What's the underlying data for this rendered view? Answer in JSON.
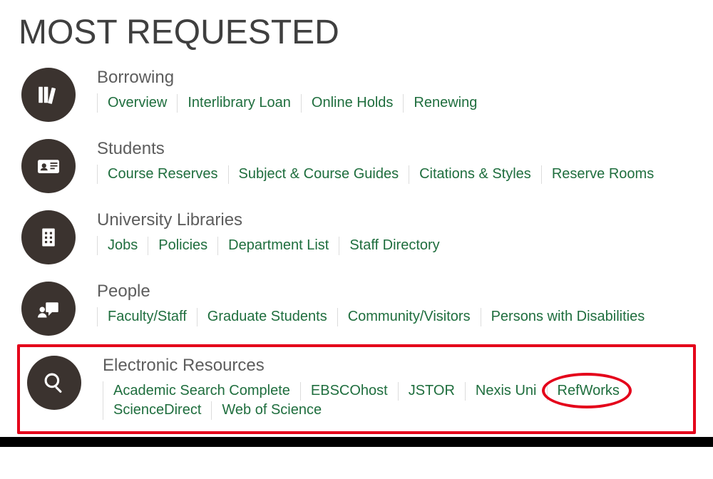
{
  "title": "MOST REQUESTED",
  "sections": [
    {
      "icon": "books-icon",
      "heading": "Borrowing",
      "links": [
        "Overview",
        "Interlibrary Loan",
        "Online Holds",
        "Renewing"
      ]
    },
    {
      "icon": "id-card-icon",
      "heading": "Students",
      "links": [
        "Course Reserves",
        "Subject & Course Guides",
        "Citations & Styles",
        "Reserve Rooms"
      ]
    },
    {
      "icon": "building-icon",
      "heading": "University Libraries",
      "links": [
        "Jobs",
        "Policies",
        "Department List",
        "Staff Directory"
      ]
    },
    {
      "icon": "people-icon",
      "heading": "People",
      "links": [
        "Faculty/Staff",
        "Graduate Students",
        "Community/Visitors",
        "Persons with Disabilities"
      ]
    },
    {
      "icon": "search-icon",
      "heading": "Electronic Resources",
      "links": [
        "Academic Search Complete",
        "EBSCOhost",
        "JSTOR",
        "Nexis Uni",
        "RefWorks",
        "ScienceDirect",
        "Web of Science"
      ]
    }
  ],
  "highlight": {
    "section_index": 4,
    "link_index": 4
  }
}
